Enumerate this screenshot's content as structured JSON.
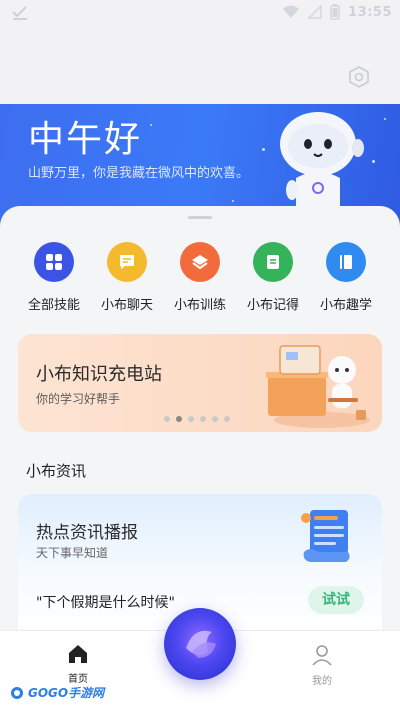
{
  "status_bar": {
    "time": "13:55"
  },
  "hero": {
    "greeting": "中午好",
    "subtitle": "山野万里，你是我藏在微风中的欢喜。"
  },
  "features": [
    {
      "label": "全部技能",
      "color": "#3c54e6",
      "icon": "grid-icon"
    },
    {
      "label": "小布聊天",
      "color": "#f5b92e",
      "icon": "chat-icon"
    },
    {
      "label": "小布训练",
      "color": "#f26b3c",
      "icon": "layers-icon"
    },
    {
      "label": "小布记得",
      "color": "#34b35a",
      "icon": "note-icon"
    },
    {
      "label": "小布趣学",
      "color": "#2f8bf0",
      "icon": "book-icon"
    }
  ],
  "banner": {
    "title": "小布知识充电站",
    "subtitle": "你的学习好帮手",
    "dots_total": 6,
    "dots_active_index": 1
  },
  "section": {
    "title": "小布资讯"
  },
  "news": {
    "title": "热点资讯播报",
    "subtitle": "天下事早知道",
    "question": "\"下个假期是什么时候\"",
    "try_label": "试试"
  },
  "nav": {
    "home_label": "首页",
    "mine_label": "我的"
  },
  "watermark": {
    "text": "GOGO手游网"
  },
  "colors": {
    "hero_blue": "#3b7af6",
    "try_green": "#36b57a",
    "banner_peach": "#fcd6bd"
  }
}
